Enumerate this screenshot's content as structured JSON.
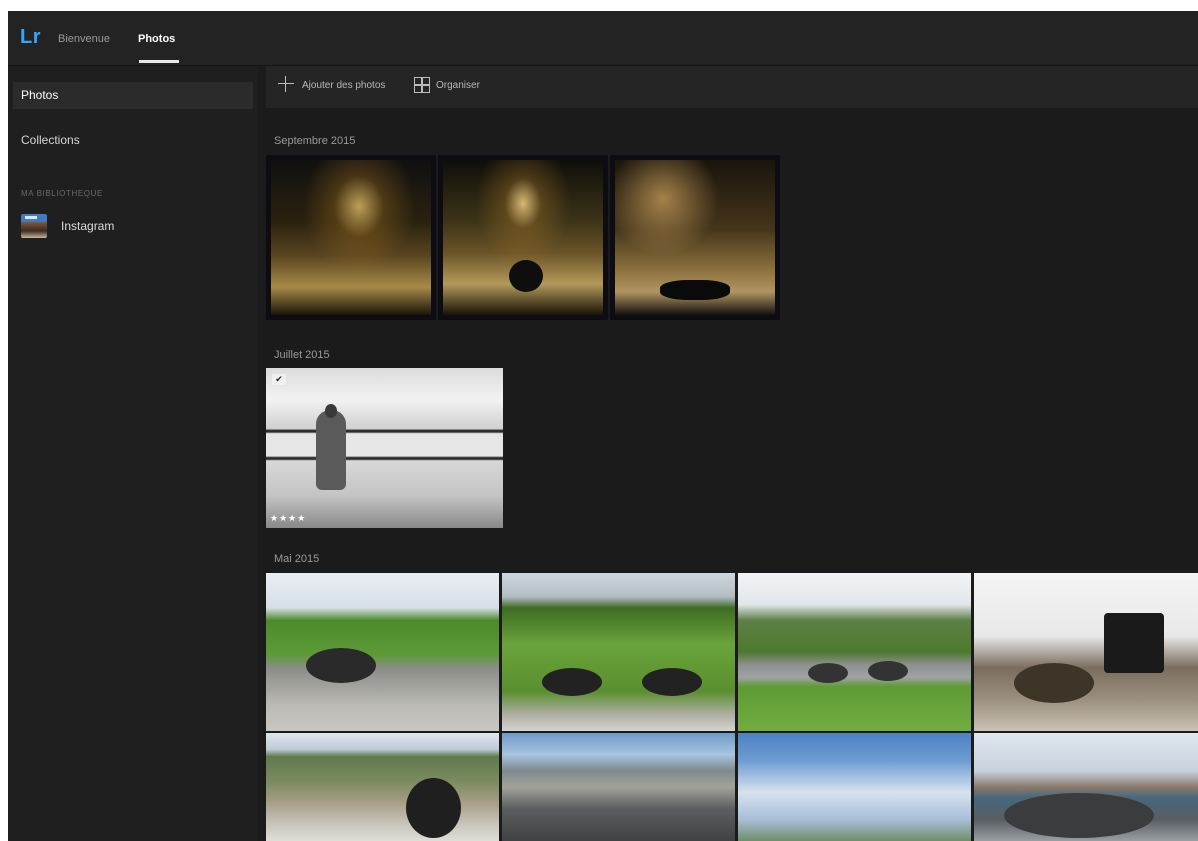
{
  "app": {
    "logo": "Lr",
    "tabs": [
      {
        "label": "Bienvenue",
        "active": false
      },
      {
        "label": "Photos",
        "active": true
      }
    ],
    "accent_color": "#31a8ff"
  },
  "sidebar": {
    "items": [
      {
        "label": "Photos",
        "active": true
      },
      {
        "label": "Collections",
        "active": false
      }
    ],
    "section_header": "MA BIBLIOTHEQUE",
    "albums": [
      {
        "label": "Instagram",
        "icon": "album-thumbnail-icon"
      }
    ]
  },
  "toolbar": {
    "add_label": "Ajouter des photos",
    "add_icon": "plus-icon",
    "organize_label": "Organiser",
    "organize_icon": "organize-grid-icon"
  },
  "groups": [
    {
      "title": "Septembre 2015",
      "photo_count": 3
    },
    {
      "title": "Juillet 2015",
      "photo_count": 1,
      "rating_stars": "★★★★"
    },
    {
      "title": "Mai 2015",
      "photo_count": 8
    }
  ]
}
